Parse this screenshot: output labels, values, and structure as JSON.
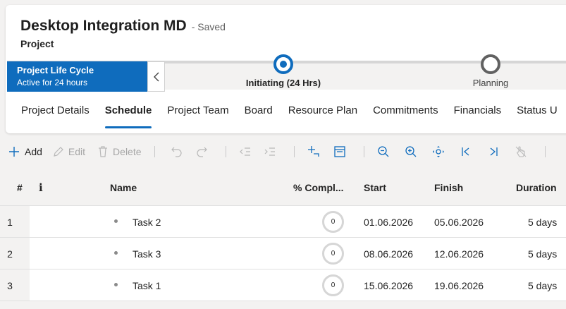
{
  "header": {
    "title": "Desktop Integration MD",
    "saved_status": "- Saved",
    "entity": "Project"
  },
  "bpf": {
    "active_process": "Project Life Cycle",
    "active_duration": "Active for 24 hours",
    "stages": [
      {
        "label": "Initiating  (24 Hrs)",
        "state": "active"
      },
      {
        "label": "Planning",
        "state": "inactive"
      }
    ]
  },
  "tabs": [
    {
      "label": "Project Details"
    },
    {
      "label": "Schedule",
      "selected": true
    },
    {
      "label": "Project Team"
    },
    {
      "label": "Board"
    },
    {
      "label": "Resource Plan"
    },
    {
      "label": "Commitments"
    },
    {
      "label": "Financials"
    },
    {
      "label": "Status U"
    }
  ],
  "toolbar": {
    "add": "Add",
    "edit": "Edit",
    "delete": "Delete"
  },
  "grid": {
    "columns": {
      "num": "#",
      "info": "i",
      "name": "Name",
      "complete": "% Compl...",
      "start": "Start",
      "finish": "Finish",
      "duration": "Duration"
    },
    "rows": [
      {
        "num": "1",
        "name": "Task 2",
        "complete": "0",
        "start": "01.06.2026",
        "finish": "05.06.2026",
        "duration": "5 days"
      },
      {
        "num": "2",
        "name": "Task 3",
        "complete": "0",
        "start": "08.06.2026",
        "finish": "12.06.2026",
        "duration": "5 days"
      },
      {
        "num": "3",
        "name": "Task 1",
        "complete": "0",
        "start": "15.06.2026",
        "finish": "19.06.2026",
        "duration": "5 days"
      }
    ]
  },
  "colors": {
    "accent": "#0f6cbd",
    "disabled": "#a6a6a6"
  }
}
